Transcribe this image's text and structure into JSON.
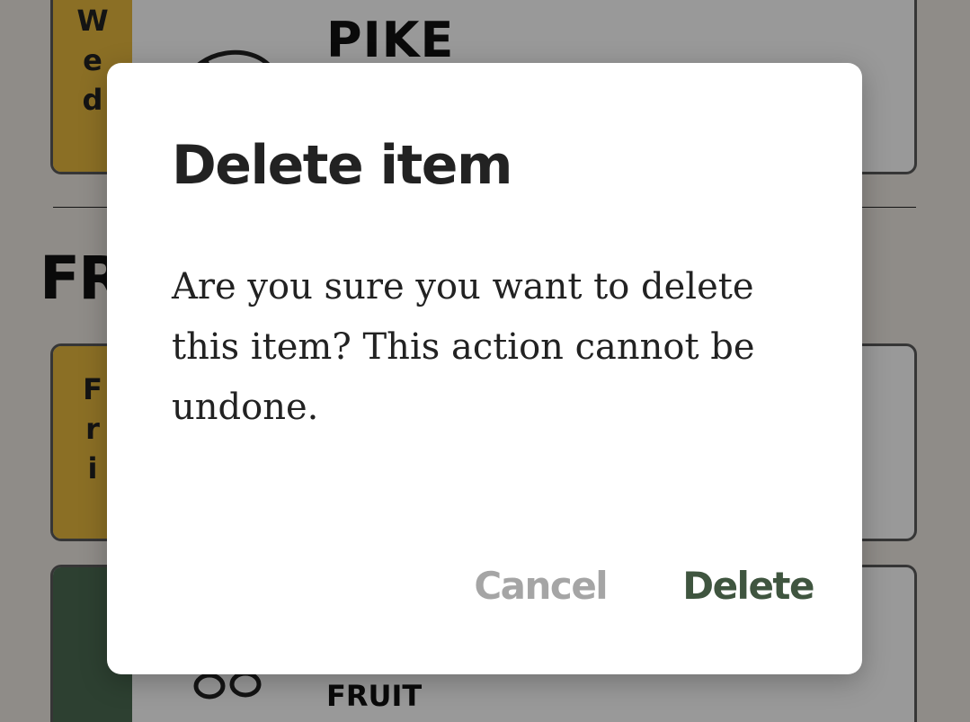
{
  "list": {
    "cards": [
      {
        "strip_letters": [
          "W",
          "e",
          "d"
        ],
        "title": "PIKE",
        "strip_color": "#e8b93e",
        "icon": "fish-icon"
      },
      {
        "strip_letters": [
          "F",
          "r",
          "i"
        ],
        "title": "",
        "strip_color": "#e8b93e",
        "icon": ""
      },
      {
        "strip_letters": [],
        "title": "FRUIT",
        "strip_color": "#4b6b53",
        "icon": "cherries-icon"
      }
    ],
    "section_heading": "FR"
  },
  "dialog": {
    "title": "Delete item",
    "message": "Are you sure you want to delete this item? This action cannot be undone.",
    "cancel_label": "Cancel",
    "delete_label": "Delete"
  },
  "colors": {
    "background": "#eeeae3",
    "accent_yellow": "#e8b93e",
    "accent_green": "#4b6b53",
    "delete_text": "#3f553f",
    "cancel_text": "#a5a5a5",
    "scrim": "rgba(0,0,0,0.40)"
  }
}
